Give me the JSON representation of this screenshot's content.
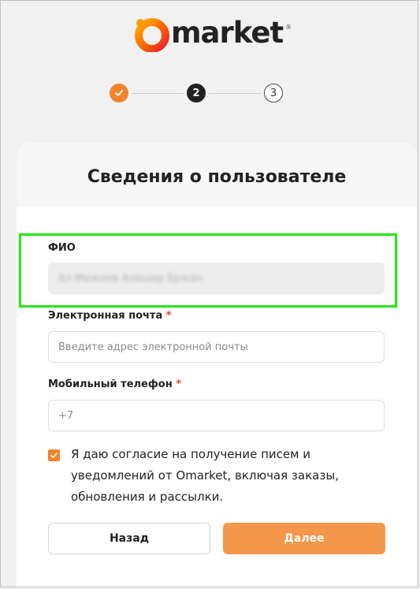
{
  "brand": {
    "name": "market",
    "reg_mark": "®",
    "colors": {
      "accent": "#f4832b",
      "accent_button": "#f4974a",
      "required": "#e8412c",
      "highlight": "#2be51d"
    }
  },
  "stepper": {
    "steps": [
      {
        "label": "",
        "state": "done",
        "icon": "check-icon"
      },
      {
        "label": "2",
        "state": "active"
      },
      {
        "label": "3",
        "state": "pending"
      }
    ]
  },
  "form": {
    "title": "Сведения о пользователе",
    "full_name": {
      "label": "ФИО",
      "value": "Ал Мажиев Алишер Ержан"
    },
    "email": {
      "label": "Электронная почта",
      "required_mark": "*",
      "placeholder": "Введите адрес электронной почты"
    },
    "phone": {
      "label": "Мобильный телефон",
      "required_mark": "*",
      "prefix": "+7"
    },
    "consent": {
      "checked": true,
      "text": "Я даю согласие на получение писем и уведомлений от Omarket, включая заказы, обновления и рассылки."
    },
    "buttons": {
      "back": "Назад",
      "next": "Далее"
    }
  }
}
